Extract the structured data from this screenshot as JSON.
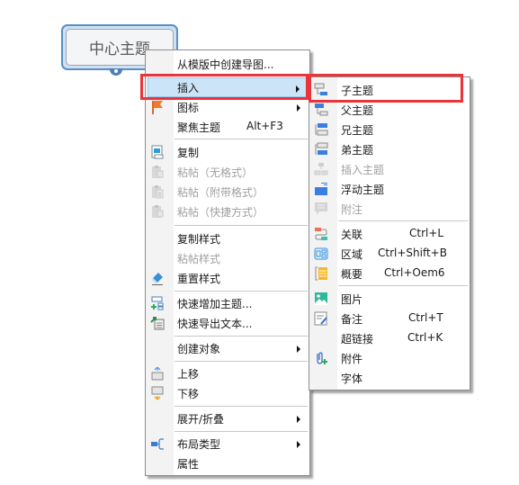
{
  "topic": {
    "label": "中心主题"
  },
  "main_menu": {
    "items": [
      {
        "label": "从模版中创建导图...",
        "icon": "",
        "shortcut": "",
        "submenu": false,
        "disabled": false
      },
      {
        "label": "插入",
        "icon": "",
        "shortcut": "",
        "submenu": true,
        "disabled": false,
        "highlighted": true
      },
      {
        "label": "图标",
        "icon": "flag-icon",
        "shortcut": "",
        "submenu": true,
        "disabled": false
      },
      {
        "label": "聚焦主题",
        "icon": "",
        "shortcut": "Alt+F3",
        "submenu": false,
        "disabled": false
      },
      {
        "label": "复制",
        "icon": "copy-icon",
        "shortcut": "",
        "submenu": false,
        "disabled": false
      },
      {
        "label": "粘帖（无格式）",
        "icon": "paste-plain-icon",
        "shortcut": "",
        "submenu": false,
        "disabled": true
      },
      {
        "label": "粘帖（附带格式）",
        "icon": "paste-formatted-icon",
        "shortcut": "",
        "submenu": false,
        "disabled": true
      },
      {
        "label": "粘帖（快捷方式）",
        "icon": "paste-shortcut-icon",
        "shortcut": "",
        "submenu": false,
        "disabled": true
      },
      {
        "label": "复制样式",
        "icon": "",
        "shortcut": "",
        "submenu": false,
        "disabled": false
      },
      {
        "label": "粘帖样式",
        "icon": "",
        "shortcut": "",
        "submenu": false,
        "disabled": true
      },
      {
        "label": "重置样式",
        "icon": "eraser-icon",
        "shortcut": "",
        "submenu": false,
        "disabled": false
      },
      {
        "label": "快速增加主题...",
        "icon": "quick-add-topic-icon",
        "shortcut": "",
        "submenu": false,
        "disabled": false
      },
      {
        "label": "快速导出文本...",
        "icon": "export-text-icon",
        "shortcut": "",
        "submenu": false,
        "disabled": false
      },
      {
        "label": "创建对象",
        "icon": "",
        "shortcut": "",
        "submenu": true,
        "disabled": false
      },
      {
        "label": "上移",
        "icon": "move-up-icon",
        "shortcut": "",
        "submenu": false,
        "disabled": false
      },
      {
        "label": "下移",
        "icon": "move-down-icon",
        "shortcut": "",
        "submenu": false,
        "disabled": false
      },
      {
        "label": "展开/折叠",
        "icon": "",
        "shortcut": "",
        "submenu": true,
        "disabled": false
      },
      {
        "label": "布局类型",
        "icon": "layout-icon",
        "shortcut": "",
        "submenu": true,
        "disabled": false
      },
      {
        "label": "属性",
        "icon": "",
        "shortcut": "",
        "submenu": false,
        "disabled": false
      }
    ]
  },
  "sub_menu": {
    "items": [
      {
        "label": "子主题",
        "icon": "subtopic-icon",
        "shortcut": "",
        "disabled": false,
        "highlighted": true
      },
      {
        "label": "父主题",
        "icon": "parent-topic-icon",
        "shortcut": "",
        "disabled": false
      },
      {
        "label": "兄主题",
        "icon": "sibling-before-icon",
        "shortcut": "",
        "disabled": false
      },
      {
        "label": "弟主题",
        "icon": "sibling-after-icon",
        "shortcut": "",
        "disabled": false
      },
      {
        "label": "插入主题",
        "icon": "insert-topic-icon",
        "shortcut": "",
        "disabled": true
      },
      {
        "label": "浮动主题",
        "icon": "floating-topic-icon",
        "shortcut": "",
        "disabled": false
      },
      {
        "label": "附注",
        "icon": "callout-icon",
        "shortcut": "",
        "disabled": true
      },
      {
        "label": "关联",
        "icon": "relationship-icon",
        "shortcut": "Ctrl+L",
        "disabled": false
      },
      {
        "label": "区域",
        "icon": "boundary-icon",
        "shortcut": "Ctrl+Shift+B",
        "disabled": false
      },
      {
        "label": "概要",
        "icon": "summary-icon",
        "shortcut": "Ctrl+Oem6",
        "disabled": false
      },
      {
        "label": "图片",
        "icon": "image-icon",
        "shortcut": "",
        "disabled": false
      },
      {
        "label": "备注",
        "icon": "note-icon",
        "shortcut": "Ctrl+T",
        "disabled": false
      },
      {
        "label": "超链接",
        "icon": "",
        "shortcut": "Ctrl+K",
        "disabled": false
      },
      {
        "label": "附件",
        "icon": "attachment-icon",
        "shortcut": "",
        "disabled": false
      },
      {
        "label": "字体",
        "icon": "",
        "shortcut": "",
        "disabled": false
      }
    ]
  },
  "colors": {
    "highlight_border": "#e8343a",
    "hover_bg": "#cce4f7",
    "topic_border": "#5b8ec4",
    "disabled_text": "#a0a0a0"
  }
}
